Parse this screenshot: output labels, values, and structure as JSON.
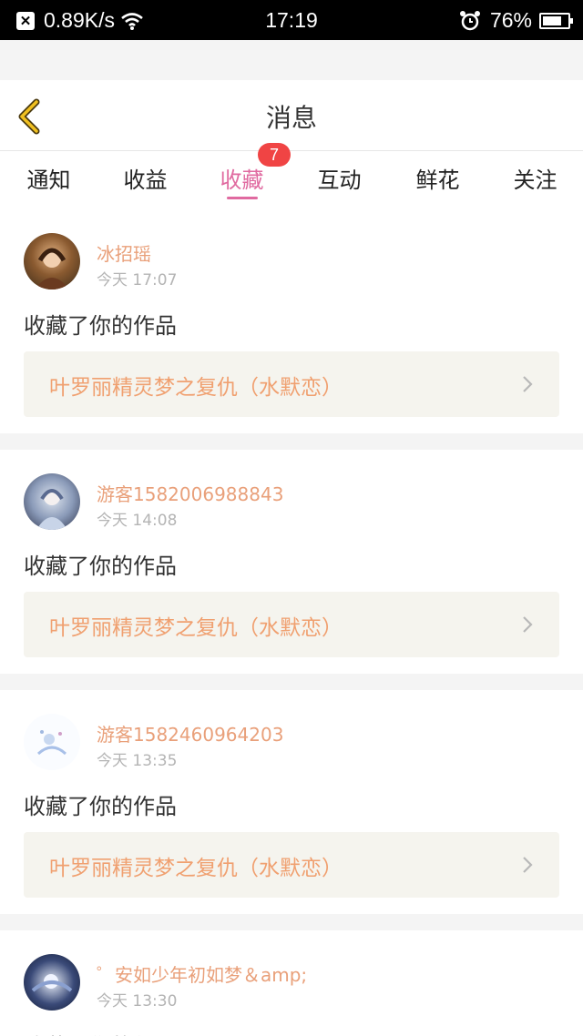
{
  "status_bar": {
    "net_speed": "0.89K/s",
    "time": "17:19",
    "battery_text": "76%",
    "battery_level": 0.76
  },
  "header": {
    "title": "消息"
  },
  "tabs": [
    {
      "label": "通知"
    },
    {
      "label": "收益"
    },
    {
      "label": "收藏",
      "active": true,
      "badge": "7"
    },
    {
      "label": "互动"
    },
    {
      "label": "鲜花"
    },
    {
      "label": "关注"
    }
  ],
  "messages": [
    {
      "username": "冰招瑶",
      "time": "今天 17:07",
      "action": "收藏了你的作品",
      "work_title": "叶罗丽精灵梦之复仇（水默恋）"
    },
    {
      "username": "游客1582006988843",
      "time": "今天 14:08",
      "action": "收藏了你的作品",
      "work_title": "叶罗丽精灵梦之复仇（水默恋）"
    },
    {
      "username": "游客1582460964203",
      "time": "今天 13:35",
      "action": "收藏了你的作品",
      "work_title": "叶罗丽精灵梦之复仇（水默恋）"
    },
    {
      "username": "゜安如少年初如梦＆amp;",
      "time": "今天 13:30",
      "action": "收藏了你的作品"
    }
  ],
  "colors": {
    "accent": "#e06aa0",
    "username": "#e9a07a",
    "work_title": "#f0a070",
    "badge": "#f04444",
    "back_icon": "#f0c020"
  }
}
